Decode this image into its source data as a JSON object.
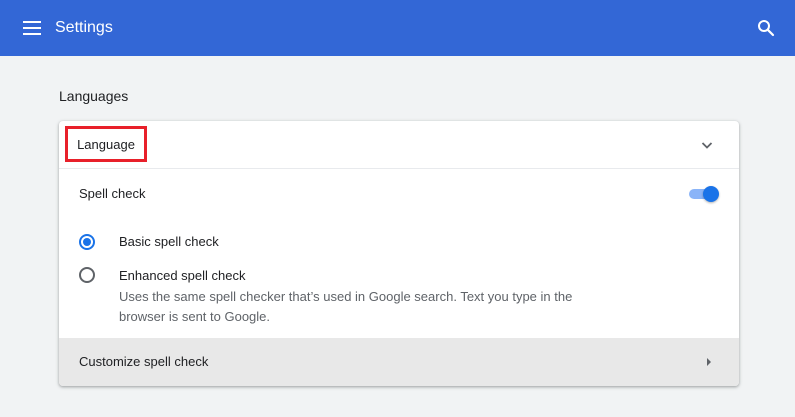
{
  "topbar": {
    "title": "Settings",
    "menu_icon": "hamburger-menu-icon",
    "search_icon": "search-icon"
  },
  "section": {
    "title": "Languages"
  },
  "language_row": {
    "label": "Language",
    "icon": "chevron-down-icon"
  },
  "spell_check": {
    "label": "Spell check",
    "enabled": true,
    "options": [
      {
        "label": "Basic spell check",
        "selected": true
      },
      {
        "label": "Enhanced spell check",
        "selected": false,
        "description": "Uses the same spell checker that’s used in Google search. Text you type in the browser is sent to Google."
      }
    ]
  },
  "customize_row": {
    "label": "Customize spell check",
    "icon": "caret-right-icon"
  },
  "colors": {
    "topbar": "#3367d6",
    "accent": "#1a73e8",
    "toggle_track": "#8ab4f8",
    "highlight_box": "#e8202a"
  }
}
